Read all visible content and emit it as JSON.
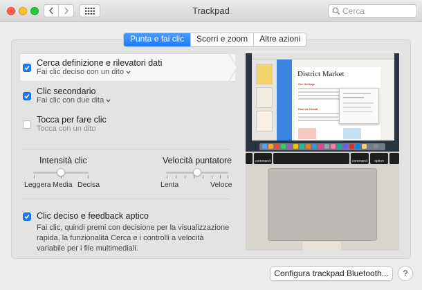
{
  "window": {
    "title": "Trackpad"
  },
  "search": {
    "placeholder": "Cerca"
  },
  "tabs": [
    {
      "label": "Punta e fai clic",
      "active": true
    },
    {
      "label": "Scorri e zoom",
      "active": false
    },
    {
      "label": "Altre azioni",
      "active": false
    }
  ],
  "features": [
    {
      "title": "Cerca definizione e rilevatori dati",
      "subtitle": "Fai clic deciso con un dito",
      "checked": true,
      "has_menu": true
    },
    {
      "title": "Clic secondario",
      "subtitle": "Fai clic con due dita",
      "checked": true,
      "has_menu": true
    },
    {
      "title": "Tocca per fare clic",
      "subtitle": "Tocca con un dito",
      "checked": false,
      "has_menu": false
    }
  ],
  "sliders": {
    "click_intensity": {
      "title": "Intensità clic",
      "labels": [
        "Leggera",
        "Media",
        "Decisa"
      ],
      "value_label": "Media"
    },
    "pointer_speed": {
      "title": "Velocità puntatore",
      "labels": [
        "Lenta",
        "Veloce"
      ],
      "position_fraction": 0.5
    }
  },
  "force_click": {
    "title": "Clic deciso e feedback aptico",
    "checked": true,
    "description": "Fai clic, quindi premi con decisione per la visualizzazione rapida, la funzionalità Cerca e i controlli a velocità variabile per i file multimediali."
  },
  "preview": {
    "doc_title": "District Market",
    "section1": "Our Heritage",
    "section2": "How we Knead",
    "keys": [
      "command",
      "command",
      "option",
      "option"
    ]
  },
  "buttons": {
    "bluetooth": "Configura trackpad Bluetooth...",
    "help": "?"
  },
  "colors": {
    "accent": "#1a7cf7",
    "selected_row_bg": "#f6f6f6"
  },
  "icons": [
    "close-icon",
    "minimize-icon",
    "zoom-icon",
    "chevron-left-icon",
    "chevron-right-icon",
    "grid-icon",
    "search-icon",
    "checkmark-icon",
    "chevron-down-icon"
  ]
}
